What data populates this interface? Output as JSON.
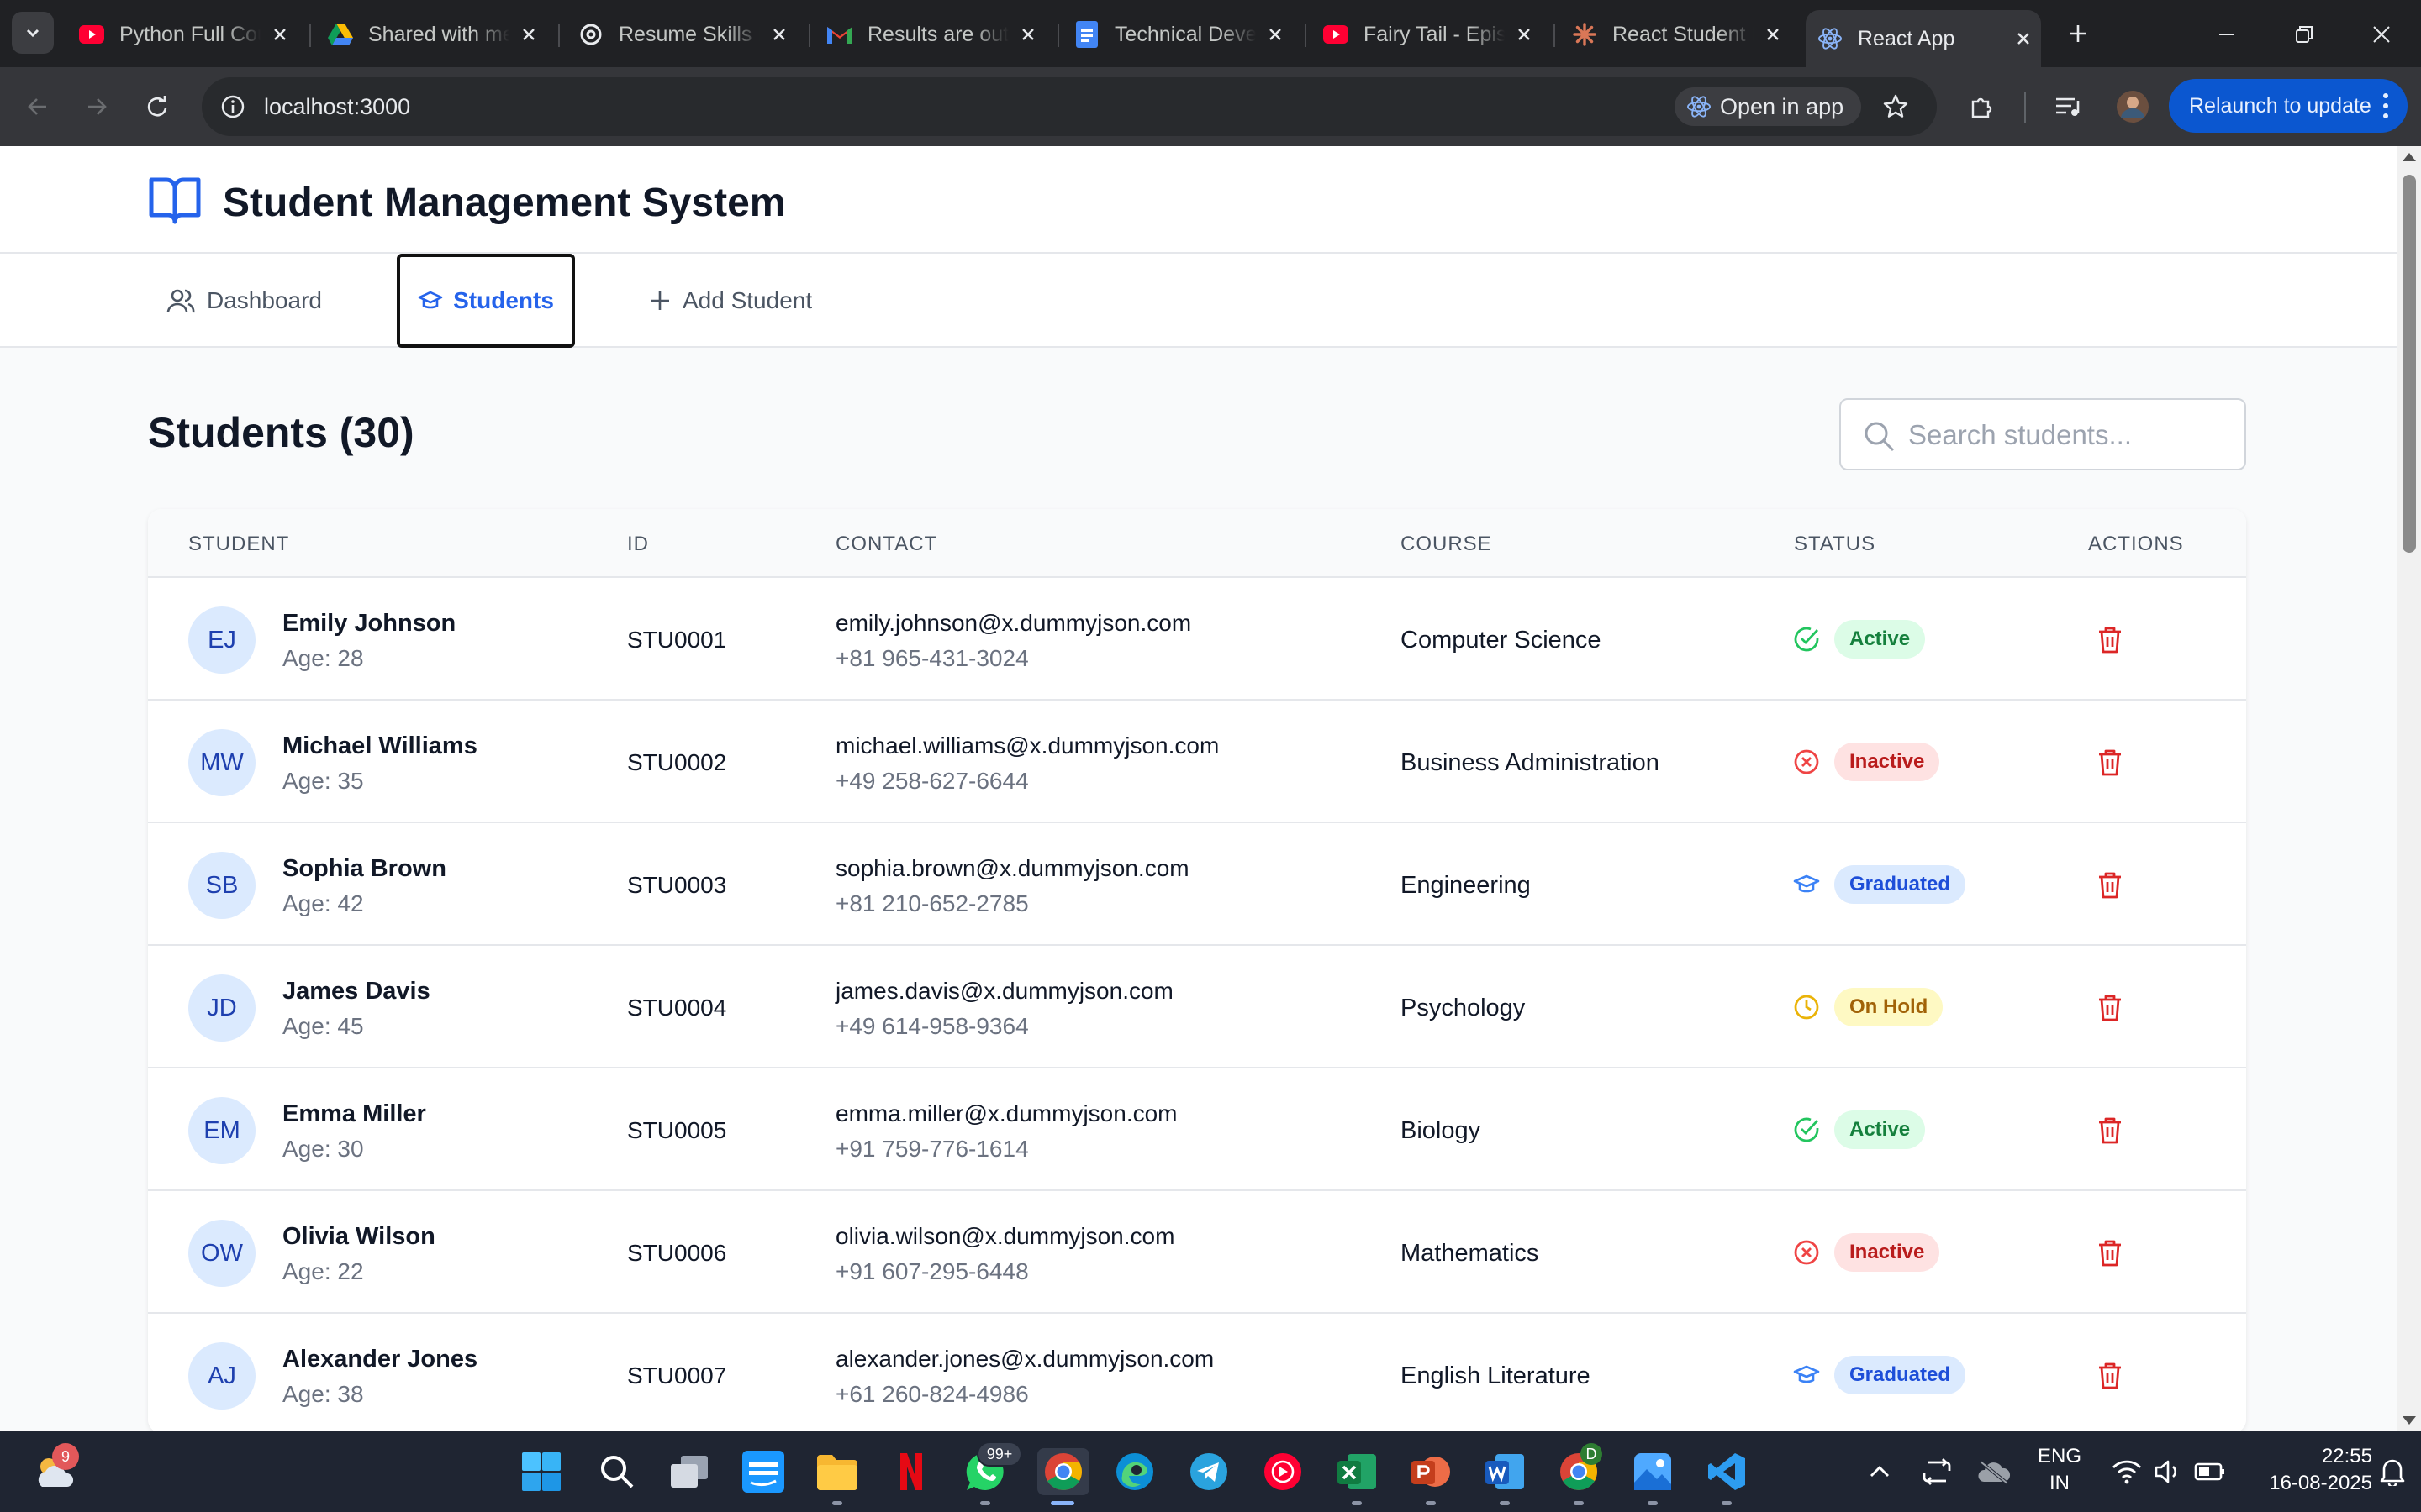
{
  "browser": {
    "tabs": [
      {
        "title": "Python Full Course",
        "favicon": "youtube-icon"
      },
      {
        "title": "Shared with me",
        "favicon": "google-drive-icon"
      },
      {
        "title": "Resume Skills Feedback",
        "favicon": "chatgpt-icon"
      },
      {
        "title": "Results are out",
        "favicon": "gmail-icon"
      },
      {
        "title": "Technical Development",
        "favicon": "google-docs-icon"
      },
      {
        "title": "Fairy Tail - Episode",
        "favicon": "youtube-icon"
      },
      {
        "title": "React Student Management",
        "favicon": "claude-icon"
      },
      {
        "title": "React App",
        "favicon": "react-icon",
        "active": true
      }
    ],
    "url": "localhost:3000",
    "open_in_app": "Open in app",
    "relaunch": "Relaunch to update"
  },
  "app": {
    "title": "Student Management System",
    "nav": {
      "dashboard": "Dashboard",
      "students": "Students",
      "add_student": "Add Student"
    },
    "page_title": "Students (30)",
    "search_placeholder": "Search students...",
    "columns": {
      "student": "STUDENT",
      "id": "ID",
      "contact": "CONTACT",
      "course": "COURSE",
      "status": "STATUS",
      "actions": "ACTIONS"
    },
    "students": [
      {
        "initials": "EJ",
        "name": "Emily Johnson",
        "age": "Age: 28",
        "id": "STU0001",
        "email": "emily.johnson@x.dummyjson.com",
        "phone": "+81 965-431-3024",
        "course": "Computer Science",
        "status": "Active"
      },
      {
        "initials": "MW",
        "name": "Michael Williams",
        "age": "Age: 35",
        "id": "STU0002",
        "email": "michael.williams@x.dummyjson.com",
        "phone": "+49 258-627-6644",
        "course": "Business Administration",
        "status": "Inactive"
      },
      {
        "initials": "SB",
        "name": "Sophia Brown",
        "age": "Age: 42",
        "id": "STU0003",
        "email": "sophia.brown@x.dummyjson.com",
        "phone": "+81 210-652-2785",
        "course": "Engineering",
        "status": "Graduated"
      },
      {
        "initials": "JD",
        "name": "James Davis",
        "age": "Age: 45",
        "id": "STU0004",
        "email": "james.davis@x.dummyjson.com",
        "phone": "+49 614-958-9364",
        "course": "Psychology",
        "status": "On Hold"
      },
      {
        "initials": "EM",
        "name": "Emma Miller",
        "age": "Age: 30",
        "id": "STU0005",
        "email": "emma.miller@x.dummyjson.com",
        "phone": "+91 759-776-1614",
        "course": "Biology",
        "status": "Active"
      },
      {
        "initials": "OW",
        "name": "Olivia Wilson",
        "age": "Age: 22",
        "id": "STU0006",
        "email": "olivia.wilson@x.dummyjson.com",
        "phone": "+91 607-295-6448",
        "course": "Mathematics",
        "status": "Inactive"
      },
      {
        "initials": "AJ",
        "name": "Alexander Jones",
        "age": "Age: 38",
        "id": "STU0007",
        "email": "alexander.jones@x.dummyjson.com",
        "phone": "+61 260-824-4986",
        "course": "English Literature",
        "status": "Graduated"
      }
    ]
  },
  "colors": {
    "accent": "#2563eb",
    "active": "#22c55e",
    "inactive": "#ef4444",
    "graduated": "#3b82f6",
    "on_hold": "#eab308",
    "delete": "#dc2626"
  },
  "taskbar": {
    "weather_badge": "9",
    "whatsapp_badge": "99+",
    "chrome_profile_badge": "D",
    "language": "ENG",
    "region": "IN",
    "time": "22:55",
    "date": "16-08-2025"
  }
}
